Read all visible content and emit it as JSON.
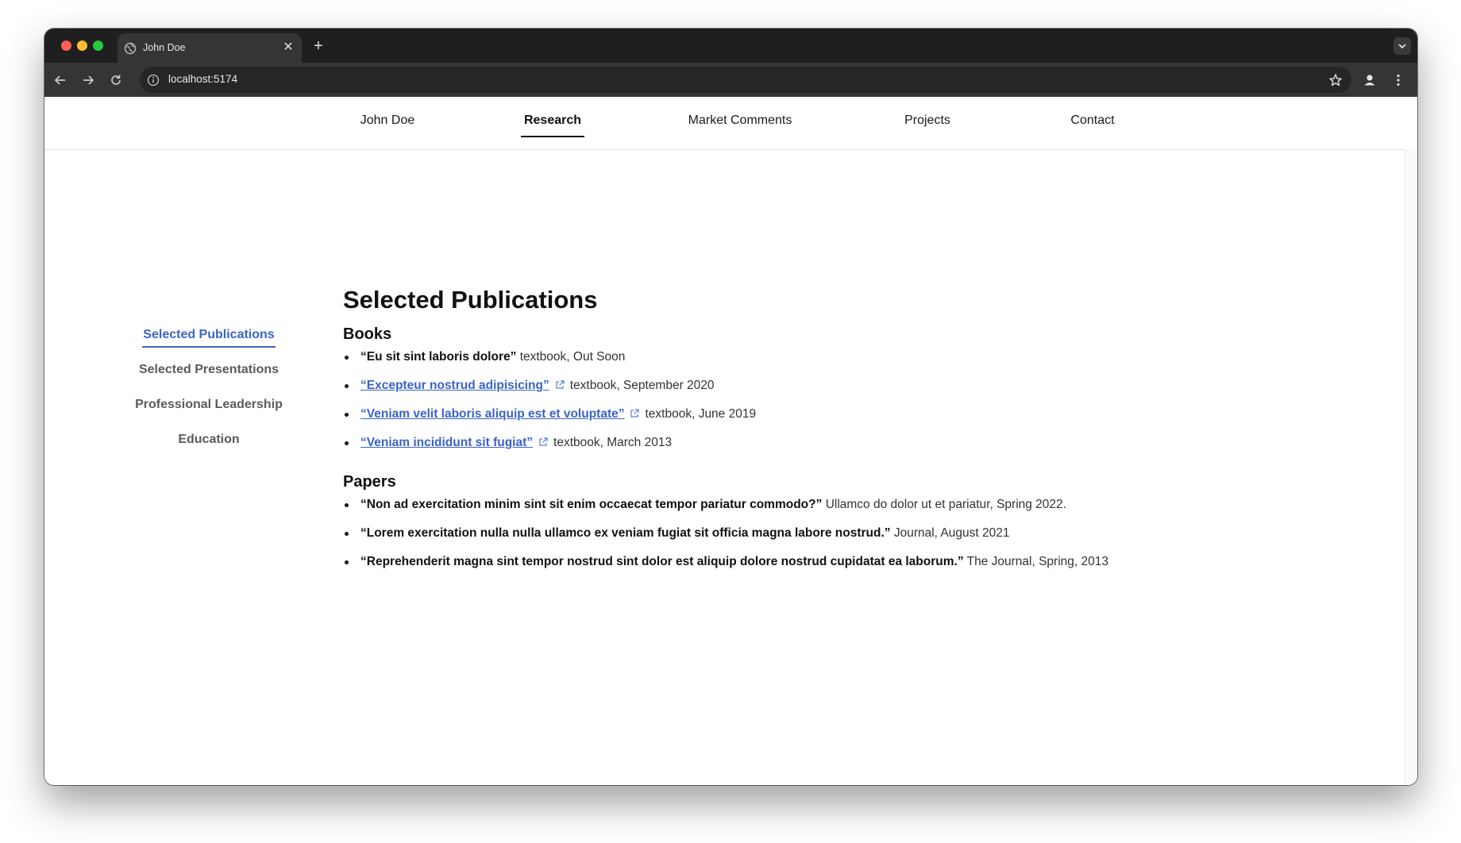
{
  "browser": {
    "tab_title": "John Doe",
    "url": "localhost:5174",
    "colors": {
      "frame": "#1f1f1f",
      "toolbar": "#353535"
    }
  },
  "nav": {
    "items": [
      {
        "label": "John Doe",
        "active": false
      },
      {
        "label": "Research",
        "active": true
      },
      {
        "label": "Market Comments",
        "active": false
      },
      {
        "label": "Projects",
        "active": false
      },
      {
        "label": "Contact",
        "active": false
      }
    ]
  },
  "sidebar": {
    "items": [
      {
        "label": "Selected Publications",
        "active": true
      },
      {
        "label": "Selected Presentations",
        "active": false
      },
      {
        "label": "Professional Leadership",
        "active": false
      },
      {
        "label": "Education",
        "active": false
      }
    ],
    "accent_color": "#3a63c9"
  },
  "content": {
    "heading": "Selected Publications",
    "books_heading": "Books",
    "books": [
      {
        "title": "“Eu sit sint laboris dolore”",
        "meta": "textbook, Out Soon",
        "link": false
      },
      {
        "title": "“Excepteur nostrud adipisicing”",
        "meta": "textbook, September 2020",
        "link": true
      },
      {
        "title": "“Veniam velit laboris aliquip est et voluptate”",
        "meta": "textbook, June 2019",
        "link": true
      },
      {
        "title": "“Veniam incididunt sit fugiat”",
        "meta": "textbook, March 2013",
        "link": true
      }
    ],
    "papers_heading": "Papers",
    "papers": [
      {
        "title": "“Non ad exercitation minim sint sit enim occaecat tempor pariatur commodo?”",
        "meta": "Ullamco do dolor ut et pariatur, Spring 2022."
      },
      {
        "title": "“Lorem exercitation nulla nulla ullamco ex veniam fugiat sit officia magna labore nostrud.”",
        "meta": "Journal, August 2021"
      },
      {
        "title": "“Reprehenderit magna sint tempor nostrud sint dolor est aliquip dolore nostrud cupidatat ea laborum.”",
        "meta": "The Journal, Spring, 2013"
      }
    ]
  }
}
